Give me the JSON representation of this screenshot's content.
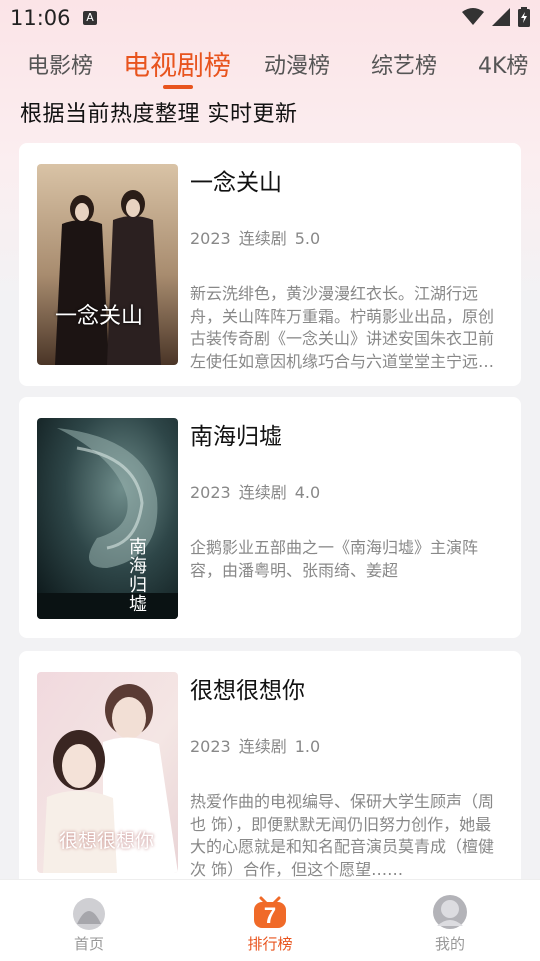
{
  "status": {
    "time": "11:06",
    "a_badge": "A"
  },
  "tabs": [
    {
      "label": "电影榜"
    },
    {
      "label": "电视剧榜"
    },
    {
      "label": "动漫榜"
    },
    {
      "label": "综艺榜"
    },
    {
      "label": "4K榜"
    }
  ],
  "active_tab": "电视剧榜",
  "subtitle": "根据当前热度整理  实时更新",
  "cards": [
    {
      "title": "一念关山",
      "year": "2023",
      "type": "连续剧",
      "score": "5.0",
      "desc": "新云洗绯色，黄沙漫漫红衣长。江湖行远舟，关山阵阵万重霜。柠萌影业出品，原创古装传奇剧《一念关山》讲述安国朱衣卫前左使任如意因机缘巧合与六道堂堂主宁远舟相识，二人携手同行……",
      "poster_text": "一念关山"
    },
    {
      "title": "南海归墟",
      "year": "2023",
      "type": "连续剧",
      "score": "4.0",
      "desc": "企鹅影业五部曲之一《南海归墟》主演阵容，由潘粤明、张雨绮、姜超",
      "poster_text": "南海归墟"
    },
    {
      "title": "很想很想你",
      "year": "2023",
      "type": "连续剧",
      "score": "1.0",
      "desc": "热爱作曲的电视编导、保研大学生顾声（周也 饰），即便默默无闻仍旧努力创作，她最大的心愿就是和知名配音演员莫青成（檀健次 饰）合作，但这个愿望……",
      "poster_text": "很想很想你"
    }
  ],
  "nav": [
    {
      "label": "首页",
      "icon": "home-avatar-icon"
    },
    {
      "label": "排行榜",
      "icon": "ranking-7-icon",
      "active": true
    },
    {
      "label": "我的",
      "icon": "profile-avatar-icon"
    }
  ],
  "colors": {
    "accent": "#e8541e",
    "bg": "#f2f2f4"
  }
}
